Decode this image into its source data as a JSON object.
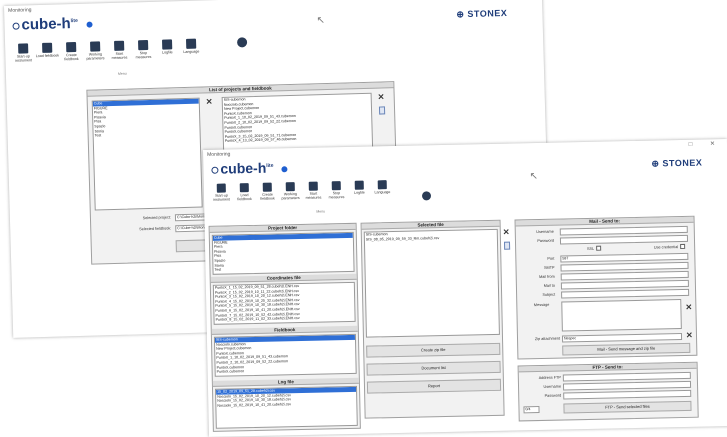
{
  "back_window": {
    "title": "Monitoring",
    "logo_text": "cube-h",
    "logo_sup": "lite",
    "brand": "STONEX",
    "toolbar": [
      {
        "label": "Start-up instrument",
        "icon": "instrument-icon"
      },
      {
        "label": "Load fieldbook",
        "icon": "load-icon"
      },
      {
        "label": "Create fieldbook",
        "icon": "create-icon"
      },
      {
        "label": "Working parameters",
        "icon": "tools-icon"
      },
      {
        "label": "Start measures",
        "icon": "start-icon"
      },
      {
        "label": "Stop measures",
        "icon": "stop-icon"
      },
      {
        "label": "Logfile",
        "icon": "logfile-icon"
      },
      {
        "label": "Language",
        "icon": "language-icon"
      }
    ],
    "toolbar_group": "Menu",
    "dialog_title": "List of projects and fieldbook",
    "projects": [
      "Cube",
      "FIGURE",
      "Piera",
      "Pisavia",
      "Pisa",
      "Spazio",
      "Storia",
      "Test"
    ],
    "fieldbooks": [
      "SIS-cubemon",
      "Nocciolo.cubemon",
      "New Project.cubemon",
      "PuntoX.cubemon",
      "PuntoX_1_10_02_2019_09_51_43.cubemon",
      "PuntoX_2_10_02_2019_09_52_22.cubemon",
      "PuntoX.cubemon",
      "PuntoX.cubemon",
      "PuntoX_3_15_02_2019_09_51_71.cubemon",
      "PuntoX_4_13_02_2019_09_57_46.cubemon"
    ],
    "selected_project_label": "Selected project:",
    "selected_project_value": "C:\\Cube-h2i\\Monit",
    "selected_fieldbook_label": "Selected fieldbook:",
    "selected_fieldbook_value": "C:\\Cube-h2i\\Monit"
  },
  "front_window": {
    "title": "Monitoring",
    "logo_text": "cube-h",
    "logo_sup": "lite",
    "brand": "STONEX",
    "toolbar": [
      {
        "label": "Start-up instrument",
        "icon": "instrument-icon"
      },
      {
        "label": "Load fieldbook",
        "icon": "load-icon"
      },
      {
        "label": "Create fieldbook",
        "icon": "create-icon"
      },
      {
        "label": "Working parameters",
        "icon": "tools-icon"
      },
      {
        "label": "Start measures",
        "icon": "start-icon"
      },
      {
        "label": "Stop measures",
        "icon": "stop-icon"
      },
      {
        "label": "Logfile",
        "icon": "logfile-icon"
      },
      {
        "label": "Language",
        "icon": "language-icon"
      }
    ],
    "toolbar_group": "Menu",
    "project_folder": {
      "title": "Project folder",
      "items": [
        "Cube",
        "FIGURE",
        "Piera",
        "Pisavia",
        "Pisa",
        "Spazio",
        "Storia",
        "Test"
      ]
    },
    "coordinate_file": {
      "title": "Coordinates file",
      "items": [
        "PuntoX_1_15_02_2019_09_51_28.cubeh2i.ENH.csv",
        "PuntoX_2_15_02_2019_10_11_22.cubeh2i.ENH.csv",
        "PuntoX_3_15_02_2019_10_20_12.cubeh2i.ENH.csv",
        "PuntoX_4_15_02_2019_10_25_32.cubeh2i.ENH.csv",
        "PuntoX_5_15_02_2019_10_30_18.cubeh2i.ENH.csv",
        "PuntoX_6_15_02_2019_10_41_20.cubeh2i.ENH.csv",
        "PuntoX_7_15_02_2019_10_52_42.cubeh2i.ENH.csv",
        "PuntoX_8_15_02_2019_11_02_33.cubeh2i.ENH.csv"
      ]
    },
    "fieldbook": {
      "title": "Fieldbook",
      "items": [
        "SIS-cubemon",
        "Nocciolo.cubemon",
        "New Project.cubemon",
        "PuntoX.cubemon",
        "PuntoX_1_10_02_2019_09_51_43.cubemon",
        "PuntoX_2_10_02_2019_09_52_22.cubemon",
        "PuntoX.cubemon",
        "PuntoX.cubemon"
      ]
    },
    "log_file": {
      "title": "Log file",
      "items": [
        "15_02_2019_09_51_28.cubeh2i.csv",
        "Nocciolo_15_02_2019_10_20_12.cubeh2i.csv",
        "Nocciolo_15_02_2019_10_30_18.cubeh2i.csv",
        "Nocciolo_15_02_2019_10_41_20.cubeh2i.csv"
      ]
    },
    "selected_file": {
      "title": "Selected file",
      "items": [
        "SIS-cubemon",
        "SIS_08_05_2019_09_59_33_Rm.cubeh2i.csv"
      ]
    },
    "buttons": {
      "create_zip": "Create zip file",
      "document_list": "Document list",
      "report": "Report"
    },
    "mail": {
      "title": "Mail - Send to:",
      "fields": [
        {
          "label": "Username",
          "value": ""
        },
        {
          "label": "Password",
          "value": ""
        },
        {
          "label": "Port",
          "value": "587"
        },
        {
          "label": "SMTP",
          "value": ""
        },
        {
          "label": "Mail from",
          "value": ""
        },
        {
          "label": "Mail to",
          "value": ""
        },
        {
          "label": "Subject",
          "value": ""
        }
      ],
      "ssl_label": "SSL",
      "use_credential_label": "Use credential",
      "message_label": "Message",
      "zip_label": "Zip attachment",
      "zip_value": "filespec",
      "send_button": "Mail - Send message and zip file"
    },
    "ftp": {
      "title": "FTP - Send to:",
      "fields": [
        {
          "label": "Address FTP",
          "value": ""
        },
        {
          "label": "Username",
          "value": ""
        },
        {
          "label": "Password",
          "value": ""
        }
      ],
      "port_value": "0/4",
      "send_button": "FTP - Send selected files"
    }
  }
}
